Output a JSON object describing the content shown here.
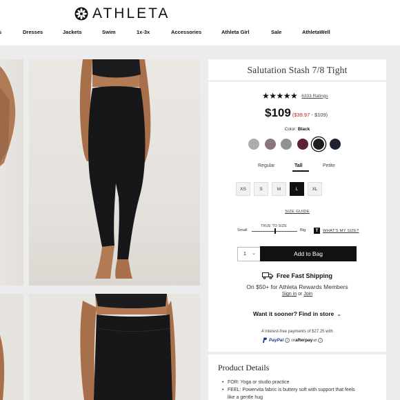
{
  "brand": {
    "logo_text": "ATHLETA",
    "icon": "athleta-flower-logo-icon"
  },
  "nav": {
    "items": [
      {
        "label": "s",
        "key": "s"
      },
      {
        "label": "Dresses",
        "key": "dresses"
      },
      {
        "label": "Jackets",
        "key": "jackets"
      },
      {
        "label": "Swim",
        "key": "swim"
      },
      {
        "label": "1x-3x",
        "key": "1x-3x"
      },
      {
        "label": "Accessories",
        "key": "accessories"
      },
      {
        "label": "Athleta Girl",
        "key": "athleta-girl"
      },
      {
        "label": "Sale",
        "key": "sale"
      },
      {
        "label": "AthletaWell",
        "key": "athletawell"
      }
    ]
  },
  "product": {
    "title": "Salutation Stash 7/8 Tight",
    "stars": "★★★★★",
    "ratings_text": "6333 Ratings",
    "price": "$109",
    "price_range_sale": "$39.97",
    "price_range_rest": " - $109)",
    "price_range_open": "(",
    "color_label": "Color:",
    "color_value": "Black",
    "swatches": [
      {
        "name": "swatch-gray",
        "color": "#a9adb3",
        "selected": false
      },
      {
        "name": "swatch-mauve",
        "color": "#8a7680",
        "selected": false
      },
      {
        "name": "swatch-sage",
        "color": "#8b958a",
        "selected": false
      },
      {
        "name": "swatch-burgundy",
        "color": "#5a2432",
        "selected": false
      },
      {
        "name": "swatch-black",
        "color": "#1b1d20",
        "selected": true
      },
      {
        "name": "swatch-navy",
        "color": "#1e2234",
        "selected": false
      }
    ],
    "fits": [
      {
        "label": "Regular",
        "selected": false
      },
      {
        "label": "Tall",
        "selected": true
      },
      {
        "label": "Petite",
        "selected": false
      }
    ],
    "sizes": [
      {
        "label": "XS",
        "selected": false
      },
      {
        "label": "S",
        "selected": false
      },
      {
        "label": "M",
        "selected": false
      },
      {
        "label": "L",
        "selected": true
      },
      {
        "label": "XL",
        "selected": false
      }
    ],
    "size_guide": "SIZE GUIDE",
    "true_to_size": "TRUE TO SIZE",
    "slider_small": "Small",
    "slider_big": "Big",
    "t_badge": "T",
    "whats_my_size": "WHAT'S MY SIZE?",
    "quantity": "1",
    "qty_chevron": "⌄",
    "add_to_bag": "Add to Bag",
    "shipping_title": "Free Fast Shipping",
    "shipping_sub": "On $50+ for Athleta Rewards Members",
    "sign_in": "Sign in",
    "or": " or ",
    "join": "Join",
    "store_text": "Want it sooner? Find in store",
    "store_chevron": "⌄",
    "payments_text": "4 interest-free payments of $27.25 with",
    "paypal": "PayPal",
    "or_short": "or",
    "afterpay": "afterpay",
    "info_icon": "i"
  },
  "details": {
    "title": "Product Details",
    "bullets": [
      "FOR: Yoga or studio practice",
      "FEEL: Powervita fabric is buttery soft with support that feels",
      "like a gentle hug"
    ]
  }
}
